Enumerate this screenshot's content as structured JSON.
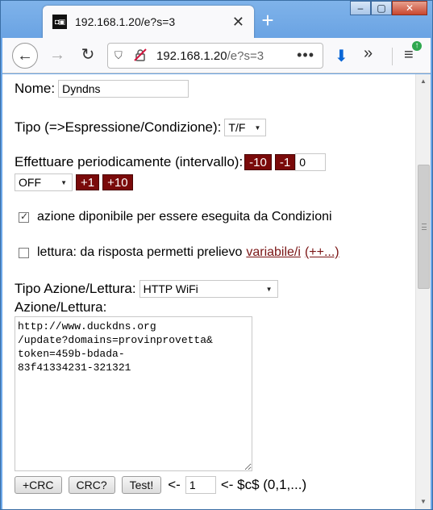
{
  "browser": {
    "tab": {
      "favicon": "◘▣",
      "title": "192.168.1.20/e?s=3",
      "close": "✕"
    },
    "new_tab": "+",
    "window_controls": {
      "minimize": "–",
      "maximize": "▢",
      "close": "✕"
    },
    "url": {
      "host": "192.168.1.20",
      "path": "/e?s=3",
      "more": "•••"
    },
    "icons": {
      "back": "←",
      "forward": "→",
      "reload": "↻",
      "shield": "⛉",
      "insecure": "🔒",
      "download": "⬇",
      "overflow": "»",
      "menu": "≡",
      "update_badge": "↑"
    }
  },
  "form": {
    "nome_label": "Nome:",
    "nome_value": "Dyndns",
    "tipo_label": "Tipo (=>Espressione/Condizione):",
    "tipo_value": "T/F",
    "periodic_label": "Effettuare periodicamente (intervallo):",
    "btn_minus10": "-10",
    "btn_minus1": "-1",
    "interval_value": "0",
    "interval_select": "OFF",
    "btn_plus1": "+1",
    "btn_plus10": "+10",
    "check_azione": "azione diponibile per essere eseguita da Condizioni",
    "check_azione_checked": true,
    "check_lettura": "lettura: da risposta permetti prelievo",
    "link_variabile": "variabile/i",
    "link_more": "(++...)",
    "check_lettura_checked": false,
    "tipo_azione_label": "Tipo Azione/Lettura:",
    "tipo_azione_value": "HTTP WiFi",
    "azione_label": "Azione/Lettura:",
    "azione_text": "http://www.duckdns.org\n/update?domains=provinprovetta&\ntoken=459b-bdada-\n83f41334231-321321",
    "btn_crc": "+CRC",
    "btn_crcq": "CRC?",
    "btn_test": "Test!",
    "arrow_left": "<-",
    "crc_value": "1",
    "crc_hint": "<- $c$ (0,1,...)"
  },
  "colors": {
    "accent_dark_red": "#7a0a0a",
    "link": "#7a1515",
    "frame": "#6aa6e8"
  }
}
